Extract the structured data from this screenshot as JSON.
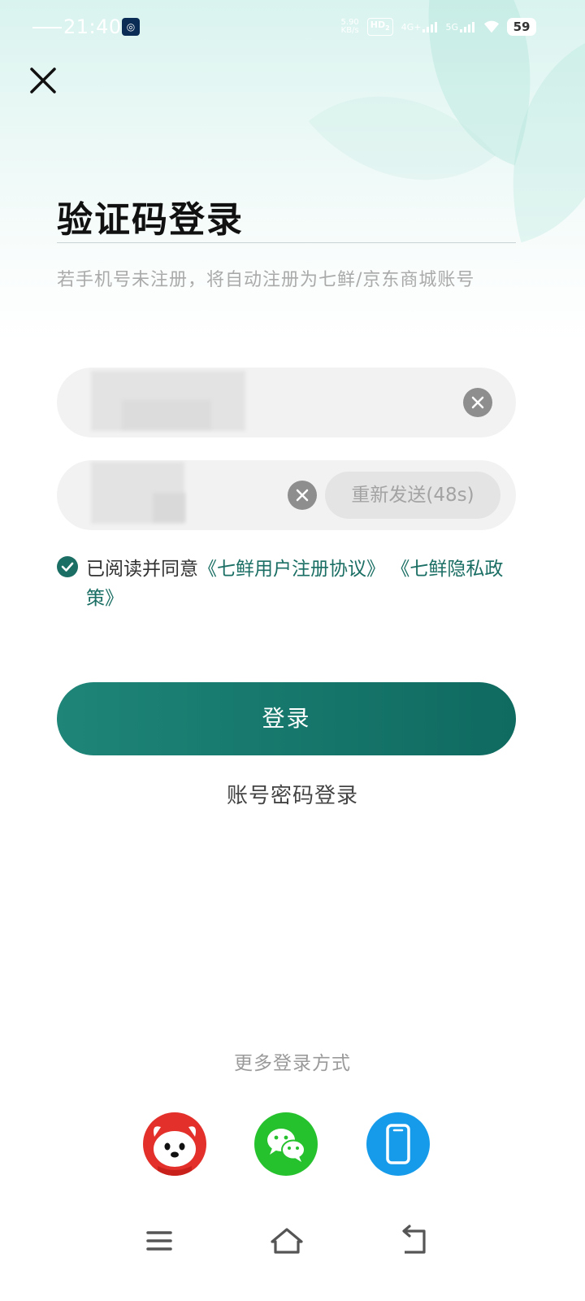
{
  "status_bar": {
    "time": "21:40",
    "net_speed_value": "5.90",
    "net_speed_unit": "KB/s",
    "hd_label": "HD",
    "hd_sub": "2",
    "network_4g": "4G+",
    "network_5g": "5G",
    "battery": "59"
  },
  "header": {
    "close_icon": "close-icon"
  },
  "title": "验证码登录",
  "subtitle": "若手机号未注册，将自动注册为七鲜/京东商城账号",
  "form": {
    "phone_input": {
      "value": ""
    },
    "code_input": {
      "value": ""
    },
    "resend_label": "重新发送(48s)"
  },
  "agreement": {
    "prefix": "已阅读并同意",
    "link1": "《七鲜用户注册协议》",
    "link2": "《七鲜隐私政策》"
  },
  "login_button": "登录",
  "password_login": "账号密码登录",
  "more_login": {
    "label": "更多登录方式",
    "options": [
      {
        "icon": "jd-mascot-icon"
      },
      {
        "icon": "wechat-icon"
      },
      {
        "icon": "phone-icon"
      }
    ]
  },
  "nav_bar": {
    "icons": [
      "menu-icon",
      "home-icon",
      "back-icon"
    ]
  },
  "colors": {
    "accent": "#1a6e63",
    "button_start": "#1e8578",
    "button_end": "#0f6a60",
    "jd_red": "#e3302a",
    "wechat_green": "#26c22e",
    "phone_blue": "#169bea"
  }
}
